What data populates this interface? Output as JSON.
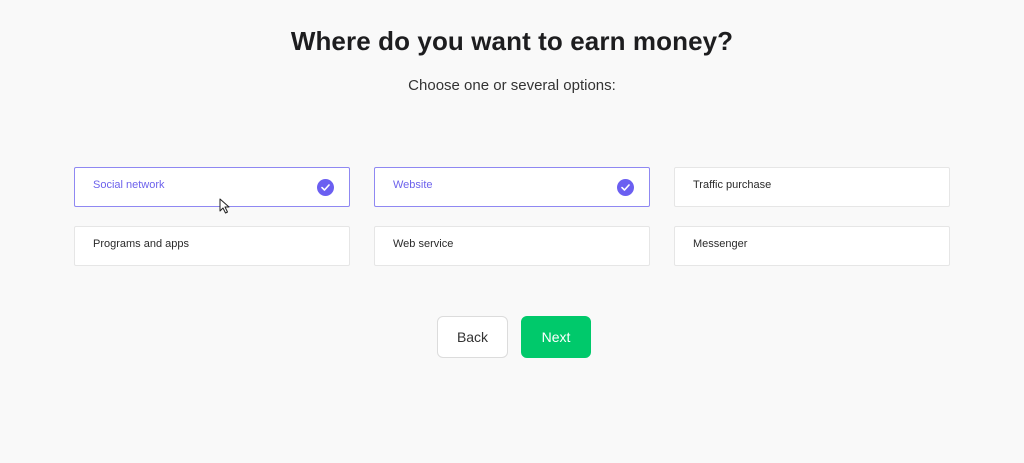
{
  "header": {
    "title": "Where do you want to earn money?",
    "subtitle": "Choose one or several options:"
  },
  "options": [
    {
      "label": "Social network",
      "selected": true
    },
    {
      "label": "Website",
      "selected": true
    },
    {
      "label": "Traffic purchase",
      "selected": false
    },
    {
      "label": "Programs and apps",
      "selected": false
    },
    {
      "label": "Web service",
      "selected": false
    },
    {
      "label": "Messenger",
      "selected": false
    }
  ],
  "actions": {
    "back_label": "Back",
    "next_label": "Next"
  },
  "colors": {
    "accent": "#6b5ff1",
    "next_button": "#00c96b",
    "background": "#f9f9f9"
  }
}
